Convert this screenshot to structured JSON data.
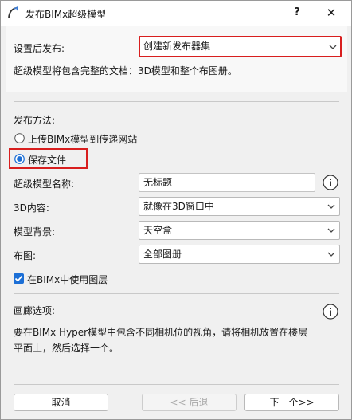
{
  "window": {
    "title": "发布BIMx超级模型",
    "help_label": "?",
    "close_label": "✕",
    "icons": {
      "app": "arc-icon",
      "help": "question-icon",
      "close": "close-icon"
    }
  },
  "publish_after": {
    "label": "设置后发布:",
    "value": "创建新发布器集",
    "description": "超级模型将包含完整的文档：3D模型和整个布图册。"
  },
  "publish_method": {
    "label": "发布方法:",
    "options": [
      {
        "label": "上传BIMx模型到传递网站",
        "selected": false
      },
      {
        "label": "保存文件",
        "selected": true
      }
    ]
  },
  "fields": {
    "name": {
      "label": "超级模型名称:",
      "value": "无标题"
    },
    "content_3d": {
      "label": "3D内容:",
      "value": "就像在3D窗口中"
    },
    "background": {
      "label": "模型背景:",
      "value": "天空盒"
    },
    "layout": {
      "label": "布图:",
      "value": "全部图册"
    }
  },
  "use_layers": {
    "label": "在BIMx中使用图层",
    "checked": true
  },
  "gallery": {
    "label": "画廊选项:",
    "description_line1": "要在BIMx Hyper模型中包含不同相机位的视角，请将相机放置在楼层",
    "description_line2": "平面上，然后选择一个。"
  },
  "buttons": {
    "cancel": "取消",
    "back": "<< 后退",
    "next": "下一个>>"
  },
  "colors": {
    "accent": "#1c6fd6",
    "highlight": "#d81e1e",
    "dialog_bg": "#f0f0f0"
  }
}
